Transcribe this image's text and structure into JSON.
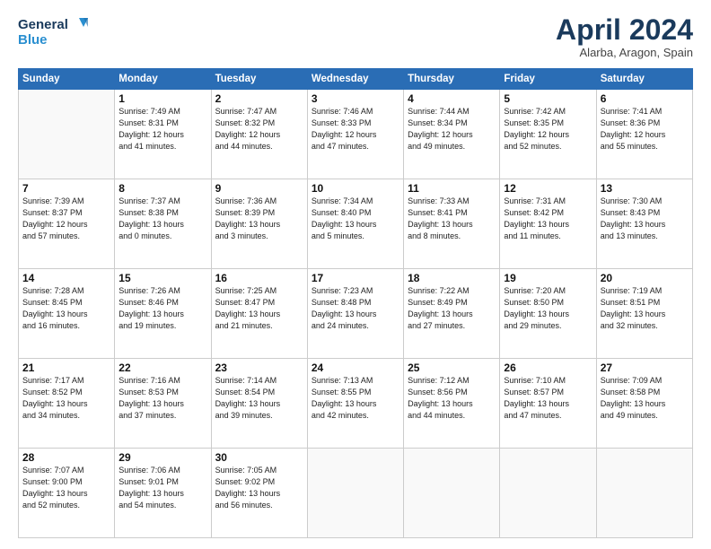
{
  "logo": {
    "line1": "General",
    "line2": "Blue"
  },
  "title": "April 2024",
  "location": "Alarba, Aragon, Spain",
  "weekdays": [
    "Sunday",
    "Monday",
    "Tuesday",
    "Wednesday",
    "Thursday",
    "Friday",
    "Saturday"
  ],
  "weeks": [
    [
      {
        "day": "",
        "info": ""
      },
      {
        "day": "1",
        "info": "Sunrise: 7:49 AM\nSunset: 8:31 PM\nDaylight: 12 hours\nand 41 minutes."
      },
      {
        "day": "2",
        "info": "Sunrise: 7:47 AM\nSunset: 8:32 PM\nDaylight: 12 hours\nand 44 minutes."
      },
      {
        "day": "3",
        "info": "Sunrise: 7:46 AM\nSunset: 8:33 PM\nDaylight: 12 hours\nand 47 minutes."
      },
      {
        "day": "4",
        "info": "Sunrise: 7:44 AM\nSunset: 8:34 PM\nDaylight: 12 hours\nand 49 minutes."
      },
      {
        "day": "5",
        "info": "Sunrise: 7:42 AM\nSunset: 8:35 PM\nDaylight: 12 hours\nand 52 minutes."
      },
      {
        "day": "6",
        "info": "Sunrise: 7:41 AM\nSunset: 8:36 PM\nDaylight: 12 hours\nand 55 minutes."
      }
    ],
    [
      {
        "day": "7",
        "info": "Sunrise: 7:39 AM\nSunset: 8:37 PM\nDaylight: 12 hours\nand 57 minutes."
      },
      {
        "day": "8",
        "info": "Sunrise: 7:37 AM\nSunset: 8:38 PM\nDaylight: 13 hours\nand 0 minutes."
      },
      {
        "day": "9",
        "info": "Sunrise: 7:36 AM\nSunset: 8:39 PM\nDaylight: 13 hours\nand 3 minutes."
      },
      {
        "day": "10",
        "info": "Sunrise: 7:34 AM\nSunset: 8:40 PM\nDaylight: 13 hours\nand 5 minutes."
      },
      {
        "day": "11",
        "info": "Sunrise: 7:33 AM\nSunset: 8:41 PM\nDaylight: 13 hours\nand 8 minutes."
      },
      {
        "day": "12",
        "info": "Sunrise: 7:31 AM\nSunset: 8:42 PM\nDaylight: 13 hours\nand 11 minutes."
      },
      {
        "day": "13",
        "info": "Sunrise: 7:30 AM\nSunset: 8:43 PM\nDaylight: 13 hours\nand 13 minutes."
      }
    ],
    [
      {
        "day": "14",
        "info": "Sunrise: 7:28 AM\nSunset: 8:45 PM\nDaylight: 13 hours\nand 16 minutes."
      },
      {
        "day": "15",
        "info": "Sunrise: 7:26 AM\nSunset: 8:46 PM\nDaylight: 13 hours\nand 19 minutes."
      },
      {
        "day": "16",
        "info": "Sunrise: 7:25 AM\nSunset: 8:47 PM\nDaylight: 13 hours\nand 21 minutes."
      },
      {
        "day": "17",
        "info": "Sunrise: 7:23 AM\nSunset: 8:48 PM\nDaylight: 13 hours\nand 24 minutes."
      },
      {
        "day": "18",
        "info": "Sunrise: 7:22 AM\nSunset: 8:49 PM\nDaylight: 13 hours\nand 27 minutes."
      },
      {
        "day": "19",
        "info": "Sunrise: 7:20 AM\nSunset: 8:50 PM\nDaylight: 13 hours\nand 29 minutes."
      },
      {
        "day": "20",
        "info": "Sunrise: 7:19 AM\nSunset: 8:51 PM\nDaylight: 13 hours\nand 32 minutes."
      }
    ],
    [
      {
        "day": "21",
        "info": "Sunrise: 7:17 AM\nSunset: 8:52 PM\nDaylight: 13 hours\nand 34 minutes."
      },
      {
        "day": "22",
        "info": "Sunrise: 7:16 AM\nSunset: 8:53 PM\nDaylight: 13 hours\nand 37 minutes."
      },
      {
        "day": "23",
        "info": "Sunrise: 7:14 AM\nSunset: 8:54 PM\nDaylight: 13 hours\nand 39 minutes."
      },
      {
        "day": "24",
        "info": "Sunrise: 7:13 AM\nSunset: 8:55 PM\nDaylight: 13 hours\nand 42 minutes."
      },
      {
        "day": "25",
        "info": "Sunrise: 7:12 AM\nSunset: 8:56 PM\nDaylight: 13 hours\nand 44 minutes."
      },
      {
        "day": "26",
        "info": "Sunrise: 7:10 AM\nSunset: 8:57 PM\nDaylight: 13 hours\nand 47 minutes."
      },
      {
        "day": "27",
        "info": "Sunrise: 7:09 AM\nSunset: 8:58 PM\nDaylight: 13 hours\nand 49 minutes."
      }
    ],
    [
      {
        "day": "28",
        "info": "Sunrise: 7:07 AM\nSunset: 9:00 PM\nDaylight: 13 hours\nand 52 minutes."
      },
      {
        "day": "29",
        "info": "Sunrise: 7:06 AM\nSunset: 9:01 PM\nDaylight: 13 hours\nand 54 minutes."
      },
      {
        "day": "30",
        "info": "Sunrise: 7:05 AM\nSunset: 9:02 PM\nDaylight: 13 hours\nand 56 minutes."
      },
      {
        "day": "",
        "info": ""
      },
      {
        "day": "",
        "info": ""
      },
      {
        "day": "",
        "info": ""
      },
      {
        "day": "",
        "info": ""
      }
    ]
  ]
}
